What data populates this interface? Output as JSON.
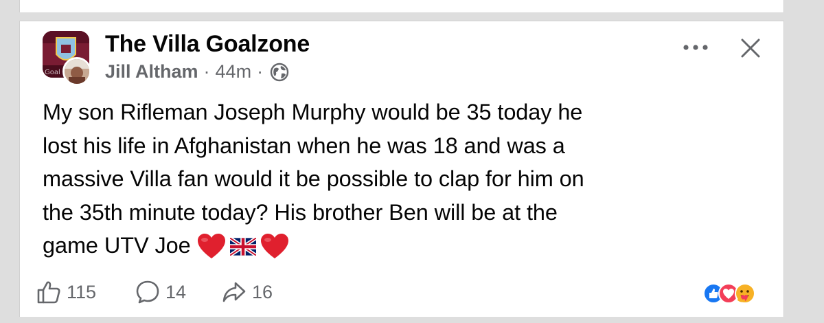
{
  "post": {
    "group_name": "The Villa Goalzone",
    "author": "Jill Altham",
    "separator": "·",
    "time": "44m",
    "avatar_text": "Goal",
    "body_lines": [
      "My son Rifleman Joseph Murphy would be 35 today he",
      "lost his life in Afghanistan when he was 18 and was a",
      "massive Villa fan would  it be possible to clap for him on",
      "the 35th minute today? His brother Ben will be at the",
      "game UTV Joe"
    ],
    "emojis": [
      "red-heart",
      "union-jack-flag",
      "red-heart"
    ]
  },
  "header": {
    "more_icon": "more-horizontal-icon",
    "close_icon": "close-icon",
    "audience_icon": "globe-icon"
  },
  "footer": {
    "likes": "115",
    "comments": "14",
    "shares": "16",
    "reaction_icons": [
      "like-reaction-icon",
      "love-reaction-icon",
      "care-reaction-icon"
    ]
  },
  "colors": {
    "text_primary": "#050505",
    "text_secondary": "#65676b",
    "like_blue": "#1877f2",
    "love_red": "#f33e58",
    "care_yellow": "#f7b125",
    "villa_claret": "#7a1c33",
    "page_bg": "#dedede",
    "card_bg": "#ffffff"
  }
}
